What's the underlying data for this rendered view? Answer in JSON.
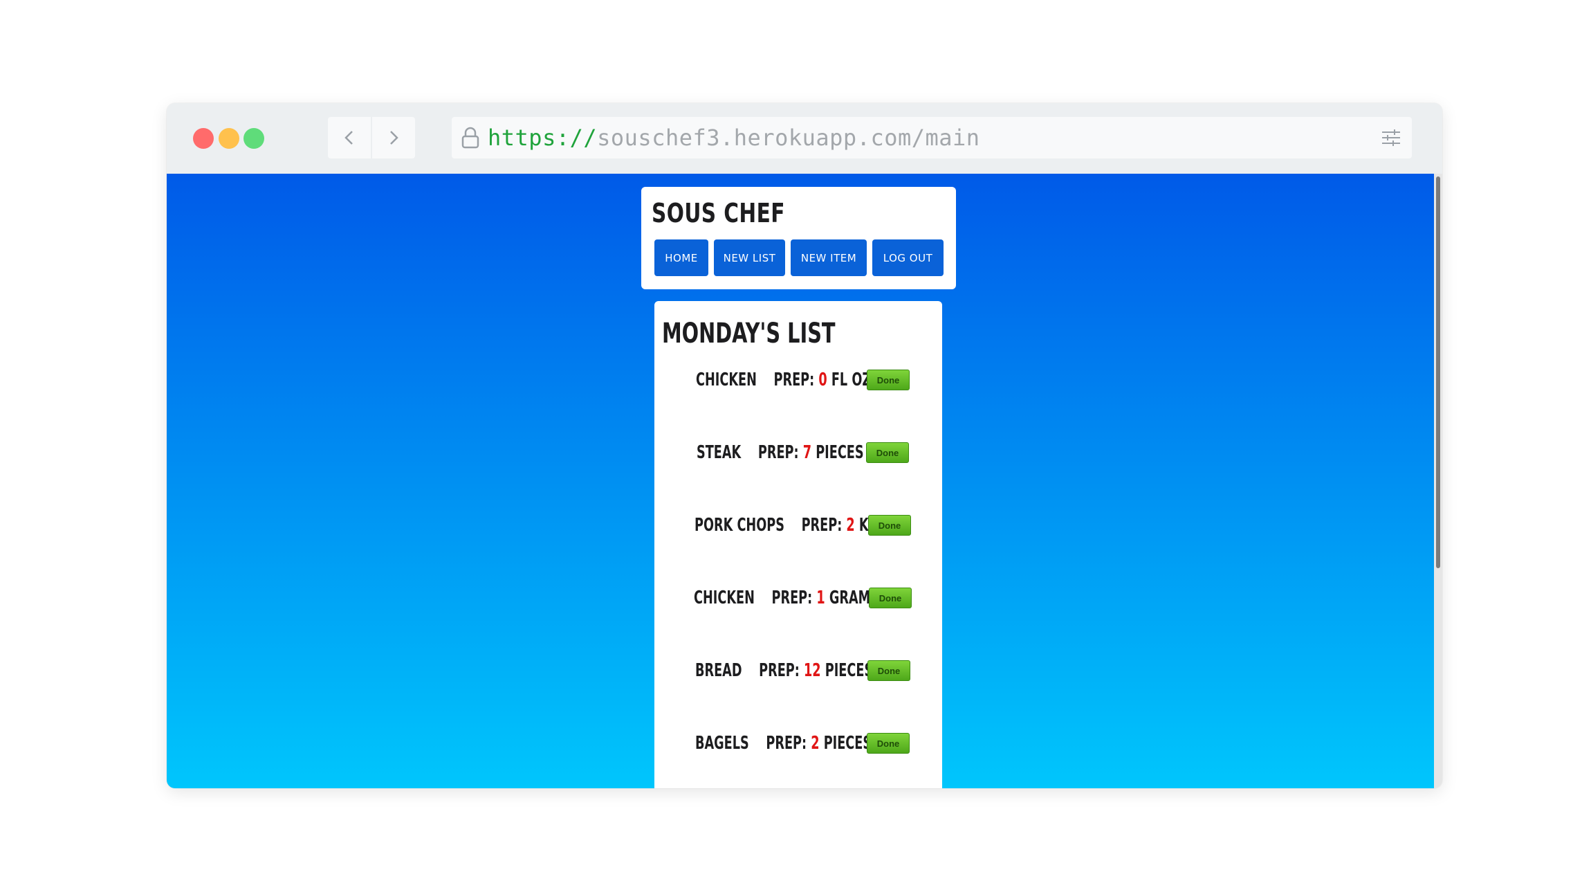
{
  "browser": {
    "url_scheme": "https://",
    "url_rest": "souschef3.herokuapp.com/main",
    "colors": {
      "close": "#ff6b6b",
      "minimize": "#ffc14d",
      "maximize": "#5fdc7a",
      "page_gradient_top": "#005ae8",
      "page_gradient_bottom": "#00c6fc"
    }
  },
  "header": {
    "brand": "SOUS CHEF",
    "nav": [
      "HOME",
      "NEW LIST",
      "NEW ITEM",
      "LOG OUT"
    ]
  },
  "list": {
    "title": "MONDAY'S LIST",
    "prep_label": "PREP:",
    "done_label": "Done",
    "items": [
      {
        "name": "CHICKEN",
        "qty": "0",
        "unit": "FL OZ"
      },
      {
        "name": "STEAK",
        "qty": "7",
        "unit": "PIECES"
      },
      {
        "name": "PORK CHOPS",
        "qty": "2",
        "unit": "KG"
      },
      {
        "name": "CHICKEN",
        "qty": "1",
        "unit": "GRAMS"
      },
      {
        "name": "BREAD",
        "qty": "12",
        "unit": "PIECES"
      },
      {
        "name": "BAGELS",
        "qty": "2",
        "unit": "PIECES"
      }
    ]
  }
}
